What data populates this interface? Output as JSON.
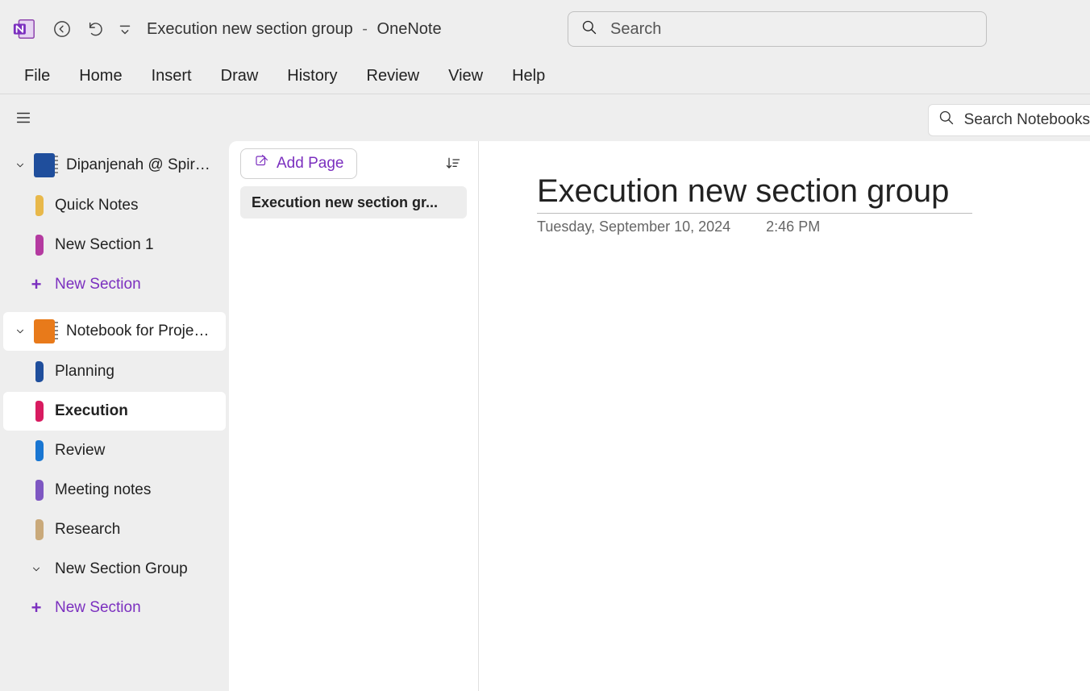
{
  "title": {
    "document": "Execution new section group",
    "separator": "-",
    "app": "OneNote"
  },
  "search": {
    "placeholder": "Search"
  },
  "ribbon": [
    "File",
    "Home",
    "Insert",
    "Draw",
    "History",
    "Review",
    "View",
    "Help"
  ],
  "subbar": {
    "search_notebooks": "Search Notebooks"
  },
  "sidebar": {
    "notebooks": [
      {
        "label": "Dipanjenah @ Spiral...",
        "color": "blue",
        "active": false,
        "sections": [
          {
            "label": "Quick Notes",
            "color": "#e8b84a",
            "active": false
          },
          {
            "label": "New Section 1",
            "color": "#b43aa0",
            "active": false
          }
        ],
        "new_section_label": "New Section"
      },
      {
        "label": "Notebook for Project A",
        "color": "orange",
        "active": true,
        "sections": [
          {
            "label": "Planning",
            "color": "#1f4e9c",
            "active": false
          },
          {
            "label": "Execution",
            "color": "#d81b60",
            "active": true
          },
          {
            "label": "Review",
            "color": "#1976d2",
            "active": false
          },
          {
            "label": "Meeting notes",
            "color": "#7e57c2",
            "active": false
          },
          {
            "label": "Research",
            "color": "#c9a97a",
            "active": false
          }
        ],
        "section_groups": [
          {
            "label": "New Section Group"
          }
        ],
        "new_section_label": "New Section"
      }
    ]
  },
  "pages": {
    "add_label": "Add Page",
    "items": [
      {
        "label": "Execution new section gr...",
        "active": true
      }
    ]
  },
  "canvas": {
    "title": "Execution new section group",
    "date": "Tuesday, September 10, 2024",
    "time": "2:46 PM"
  }
}
